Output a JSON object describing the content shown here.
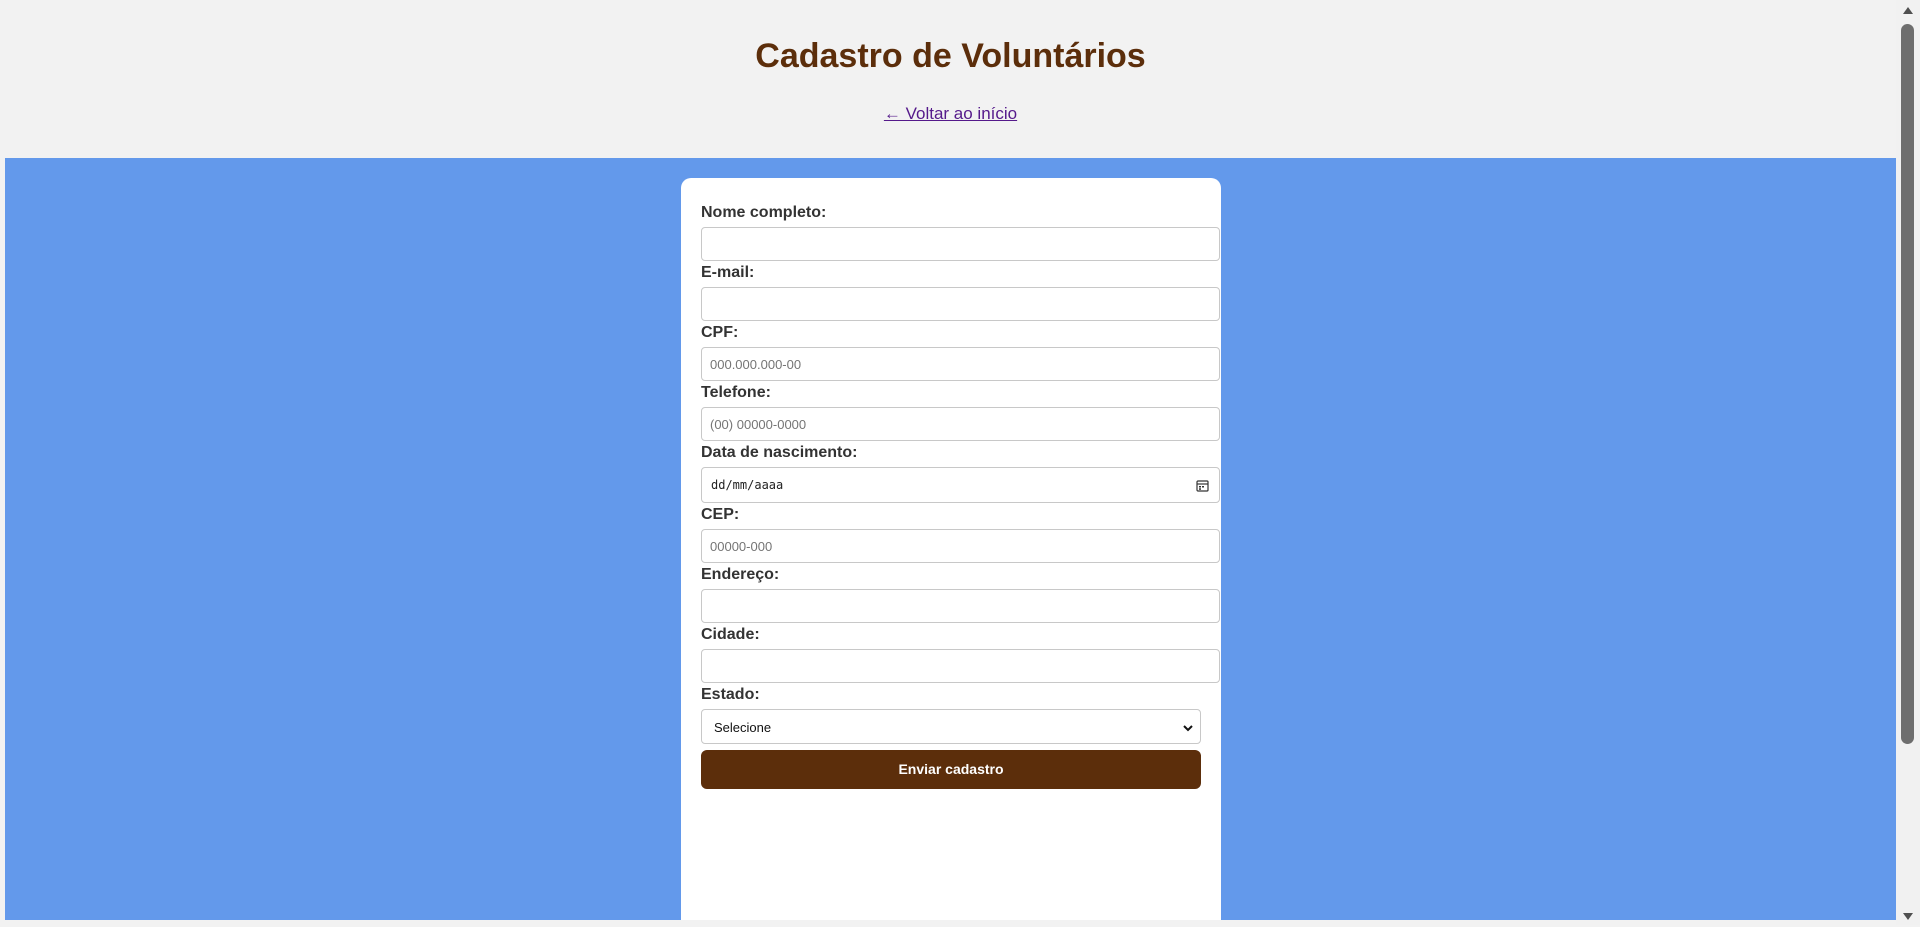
{
  "header": {
    "title": "Cadastro de Voluntários",
    "back_link": "← Voltar ao início"
  },
  "form": {
    "nome": {
      "label": "Nome completo:",
      "placeholder": ""
    },
    "email": {
      "label": "E-mail:",
      "placeholder": ""
    },
    "cpf": {
      "label": "CPF:",
      "placeholder": "000.000.000-00"
    },
    "telefone": {
      "label": "Telefone:",
      "placeholder": "(00) 00000-0000"
    },
    "nascimento": {
      "label": "Data de nascimento:",
      "placeholder": "dd/mm/aaaa",
      "icon": "calendar-icon"
    },
    "cep": {
      "label": "CEP:",
      "placeholder": "00000-000"
    },
    "endereco": {
      "label": "Endereço:",
      "placeholder": ""
    },
    "cidade": {
      "label": "Cidade:",
      "placeholder": ""
    },
    "estado": {
      "label": "Estado:",
      "selected": "Selecione",
      "icon": "chevron-down-icon"
    },
    "submit_label": "Enviar cadastro"
  },
  "colors": {
    "title": "#5c2e0b",
    "background": "#6399eb",
    "button": "#5c2e0b",
    "link": "#551a8b"
  }
}
